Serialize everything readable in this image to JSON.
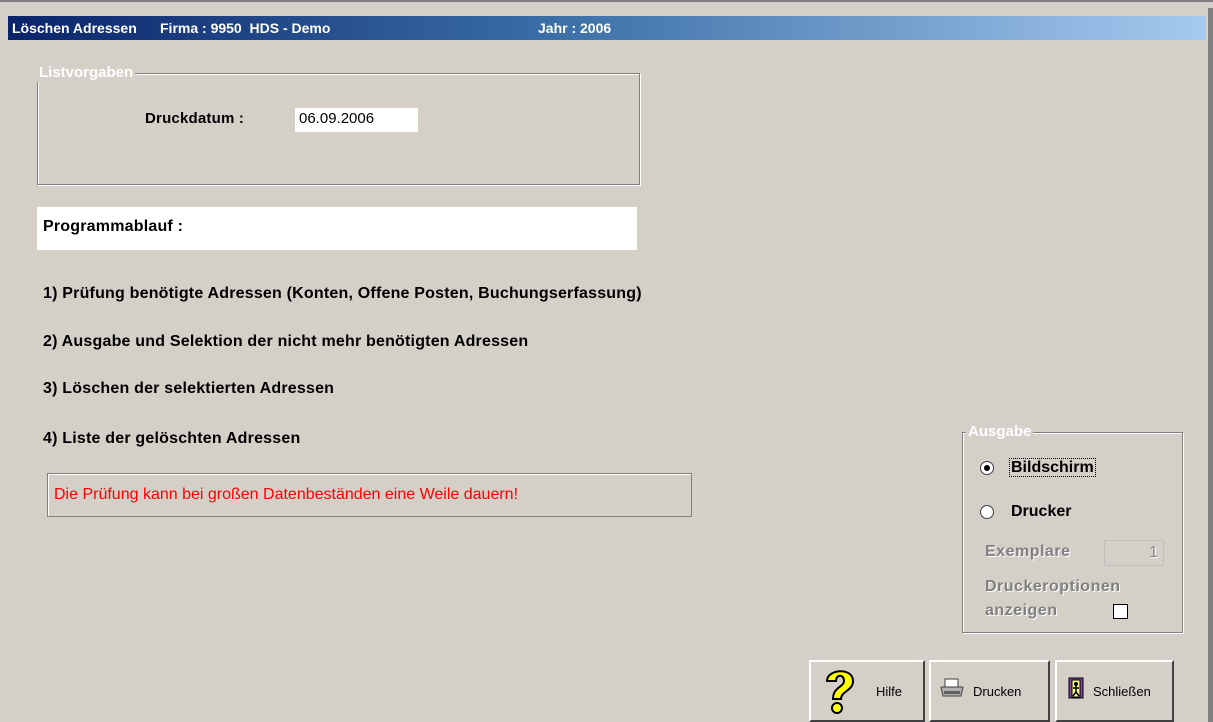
{
  "window": {
    "title": "Löschen Adressen",
    "firma_label": "Firma : 9950  HDS - Demo",
    "jahr_label": "Jahr : 2006"
  },
  "listvorgaben": {
    "legend": "Listvorgaben",
    "druckdatum_label": "Druckdatum :",
    "druckdatum_value": "06.09.2006"
  },
  "programmablauf": {
    "header": "Programmablauf :",
    "steps": [
      "1) Prüfung benötigte Adressen (Konten, Offene Posten, Buchungserfassung)",
      "2) Ausgabe und Selektion der nicht mehr benötigten Adressen",
      "3) Löschen der selektierten Adressen",
      "4) Liste der gelöschten Adressen"
    ],
    "warning": "Die Prüfung kann bei großen Datenbeständen eine Weile dauern!",
    "warning_color": "#ff0000"
  },
  "ausgabe": {
    "legend": "Ausgabe",
    "options": [
      {
        "label": "Bildschirm",
        "selected": true
      },
      {
        "label": "Drucker",
        "selected": false
      }
    ],
    "exemplare_label": "Exemplare",
    "exemplare_value": "1",
    "druckeroptionen_line1": "Druckeroptionen",
    "druckeroptionen_line2": "anzeigen",
    "druckeroptionen_checked": false
  },
  "buttons": {
    "hilfe": {
      "label": "Hilfe",
      "icon": "question-mark-icon"
    },
    "drucken": {
      "label": "Drucken",
      "icon": "printer-icon"
    },
    "schliessen": {
      "label": "Schließen",
      "icon": "exit-door-icon"
    }
  }
}
